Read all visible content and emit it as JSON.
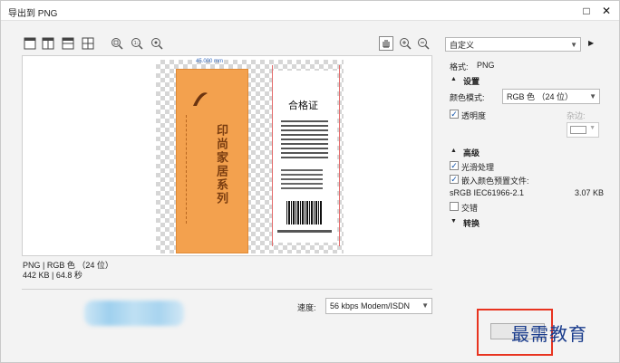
{
  "window": {
    "title": "导出到 PNG"
  },
  "preset": {
    "value": "自定义"
  },
  "format": {
    "label": "格式:",
    "value": "PNG"
  },
  "settings": {
    "heading": "设置",
    "color_mode_label": "颜色模式:",
    "color_mode_value": "RGB 色 （24 位）",
    "transparency_label": "透明度",
    "transparency_checked": true,
    "matte_label": "杂边:"
  },
  "advanced": {
    "heading": "高级",
    "smoothing_label": "光滑处理",
    "smoothing_checked": true,
    "embed_profile_label": "嵌入颜色预置文件:",
    "embed_profile_checked": true,
    "profile_name": "sRGB IEC61966-2.1",
    "profile_size": "3.07 KB",
    "interlace_label": "交错",
    "interlace_checked": false
  },
  "transform": {
    "heading": "转换"
  },
  "preview": {
    "dimension": "45.000 mm",
    "label_title": "合格证",
    "product_name": "印尚家居系列"
  },
  "info": {
    "line1": "PNG | RGB 色 （24 位）",
    "line2": "442 KB | 64.8 秒"
  },
  "speed": {
    "label": "速度:",
    "value": "56 kbps Modem/ISDN"
  },
  "watermark": {
    "text": "最需教育"
  },
  "colors": {
    "accent_orange": "#f3a14e",
    "highlight_red": "#e8331f",
    "watermark_blue": "#1a3c8c"
  }
}
